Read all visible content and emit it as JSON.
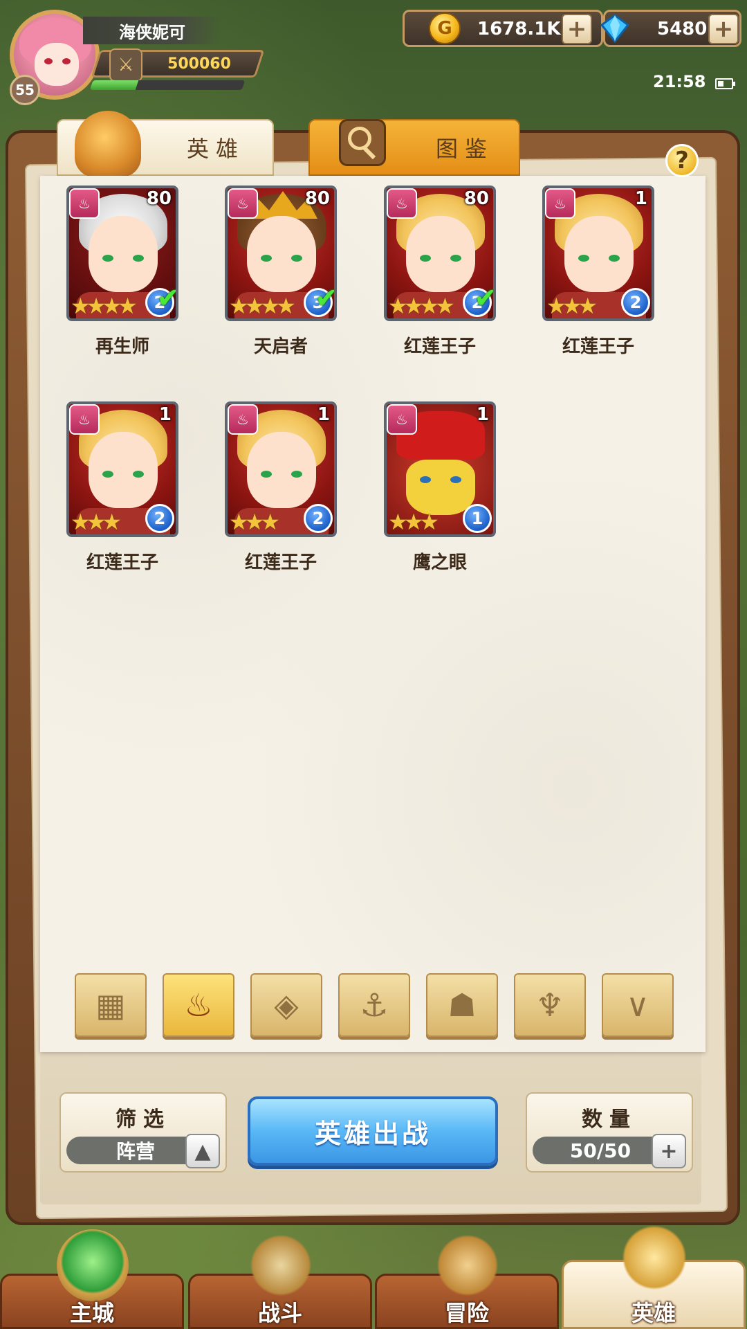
{
  "player": {
    "name": "海侠妮可",
    "level": "55",
    "power": "500060",
    "exp_fraction": 0.3
  },
  "resources": {
    "gold": "1678.1K",
    "gems": "5480"
  },
  "status": {
    "time": "21:58"
  },
  "tabs": [
    {
      "label": "英雄"
    },
    {
      "label": "图鉴"
    }
  ],
  "heroes": [
    {
      "name": "再生师",
      "level": "80",
      "stars": "★★★★",
      "rank": "2",
      "checked": true
    },
    {
      "name": "天启者",
      "level": "80",
      "stars": "★★★★",
      "rank": "3",
      "checked": true
    },
    {
      "name": "红莲王子",
      "level": "80",
      "stars": "★★★★",
      "rank": "2",
      "checked": true
    },
    {
      "name": "红莲王子",
      "level": "1",
      "stars": "★★★",
      "rank": "2",
      "checked": false
    },
    {
      "name": "红莲王子",
      "level": "1",
      "stars": "★★★",
      "rank": "2",
      "checked": false
    },
    {
      "name": "红莲王子",
      "level": "1",
      "stars": "★★★",
      "rank": "2",
      "checked": false
    },
    {
      "name": "鹰之眼",
      "level": "1",
      "stars": "★★★",
      "rank": "1",
      "checked": false
    }
  ],
  "faction_filters": [
    {
      "icon": "grid-icon",
      "glyph": "▦",
      "active": false
    },
    {
      "icon": "flame-faction-icon",
      "glyph": "♨",
      "active": true
    },
    {
      "icon": "diamond-faction-icon",
      "glyph": "◈",
      "active": false
    },
    {
      "icon": "anchor-faction-icon",
      "glyph": "⚓",
      "active": false
    },
    {
      "icon": "beast-faction-icon",
      "glyph": "☗",
      "active": false
    },
    {
      "icon": "horned-faction-icon",
      "glyph": "♆",
      "active": false
    },
    {
      "icon": "wing-faction-icon",
      "glyph": "∨",
      "active": false
    }
  ],
  "filter": {
    "title": "筛选",
    "value": "阵营"
  },
  "deploy_button": "英雄出战",
  "count": {
    "title": "数量",
    "value": "50/50"
  },
  "nav": [
    {
      "label": "主城",
      "active": false
    },
    {
      "label": "战斗",
      "active": false
    },
    {
      "label": "冒险",
      "active": false
    },
    {
      "label": "英雄",
      "active": true
    }
  ],
  "colors": {
    "accent_blue": "#3c96e4",
    "tab_orange": "#f5b338",
    "faction_pink": "#e35a88",
    "wood_frame": "#8e5c34"
  }
}
